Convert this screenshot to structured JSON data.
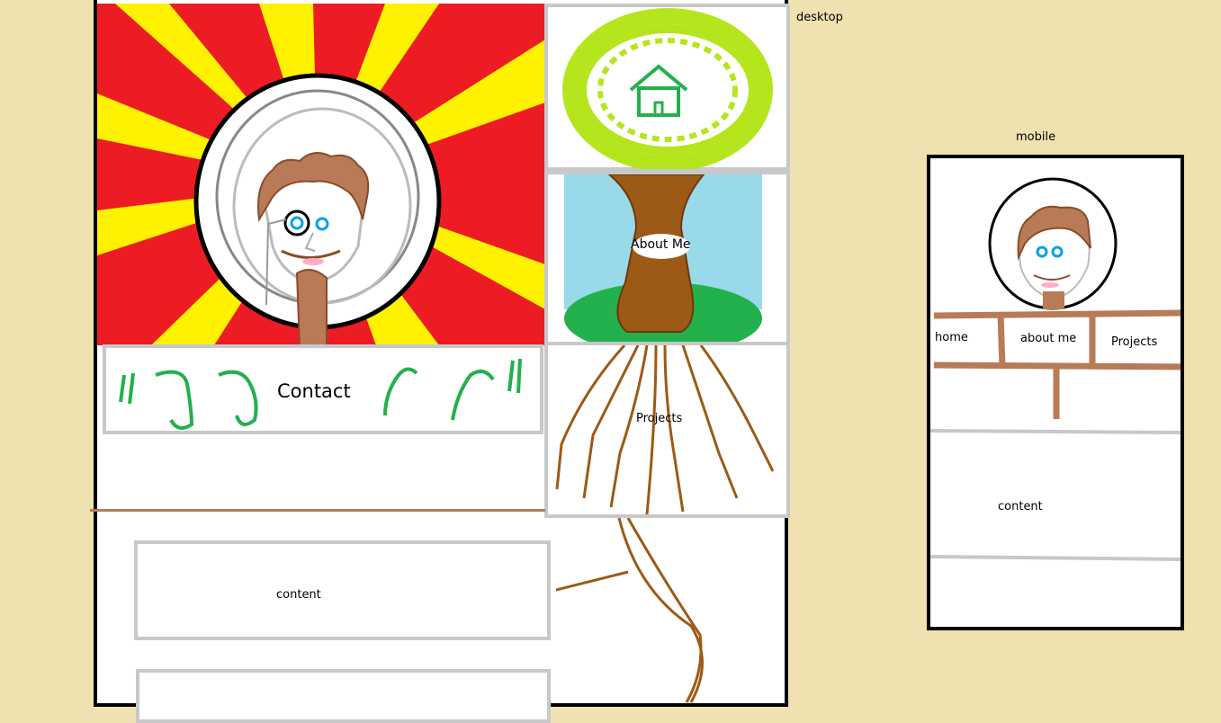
{
  "labels": {
    "desktop": "desktop",
    "mobile": "mobile"
  },
  "desktop_nav": {
    "about": "About Me",
    "contact": "Contact",
    "projects": "Projects"
  },
  "desktop_content": {
    "block1": "content"
  },
  "mobile_nav": {
    "home": "home",
    "about": "about me",
    "projects": "Projects"
  },
  "mobile_content": {
    "block1": "content"
  },
  "colors": {
    "background": "#efe2b0",
    "sun_red": "#ed1c24",
    "sun_yellow": "#fff200",
    "leaf_green": "#b5e61d",
    "house_green": "#22b14c",
    "sky_blue": "#99d9ea",
    "trunk_brown": "#9c5a16",
    "beard_brown": "#b97a57",
    "eye_blue": "#00a2e8",
    "frame_gray": "#c8c8c8"
  },
  "icons": [
    "house-icon",
    "phone-icon"
  ]
}
